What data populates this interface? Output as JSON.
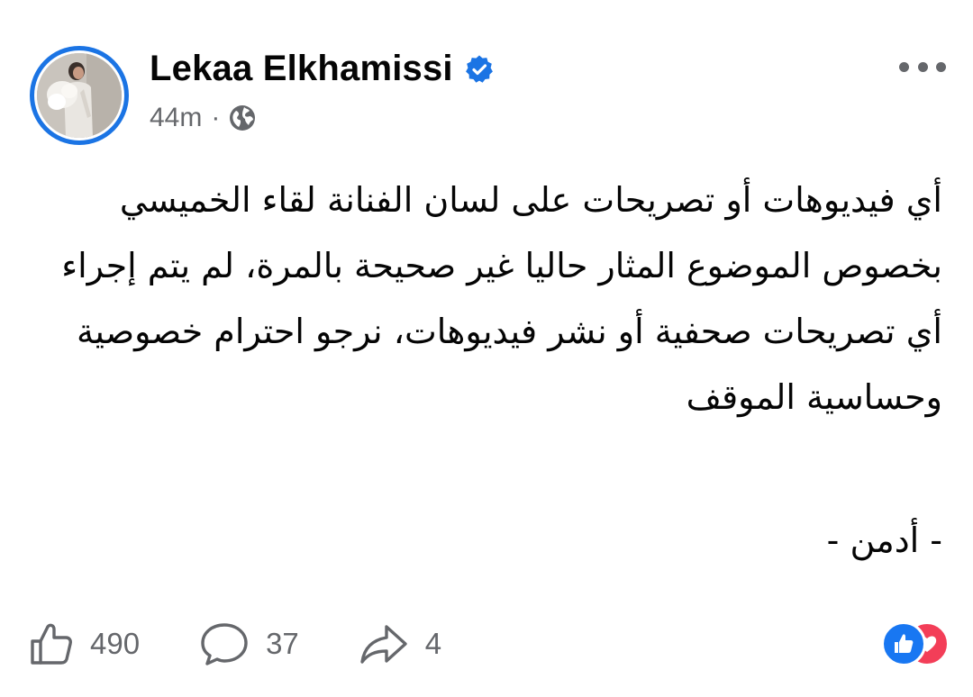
{
  "author": {
    "name": "Lekaa Elkhamissi",
    "verified": true,
    "time": "44m",
    "separator": "·",
    "audience_icon": "globe-icon"
  },
  "post": {
    "lines": [
      "أي فيديوهات أو تصريحات على لسان الفنانة لقاء الخميسي",
      "بخصوص الموضوع المثار حاليا غير صحيحة بالمرة، لم يتم إجراء",
      "أي تصريحات صحفية أو نشر فيديوهات، نرجو احترام خصوصية",
      "وحساسية الموقف"
    ],
    "signature": "- أدمن -"
  },
  "actions": {
    "likes": "490",
    "comments": "37",
    "shares": "4"
  },
  "colors": {
    "accent": "#1b74e4",
    "muted": "#65676b",
    "like": "#1877f2",
    "love": "#f33e58"
  }
}
